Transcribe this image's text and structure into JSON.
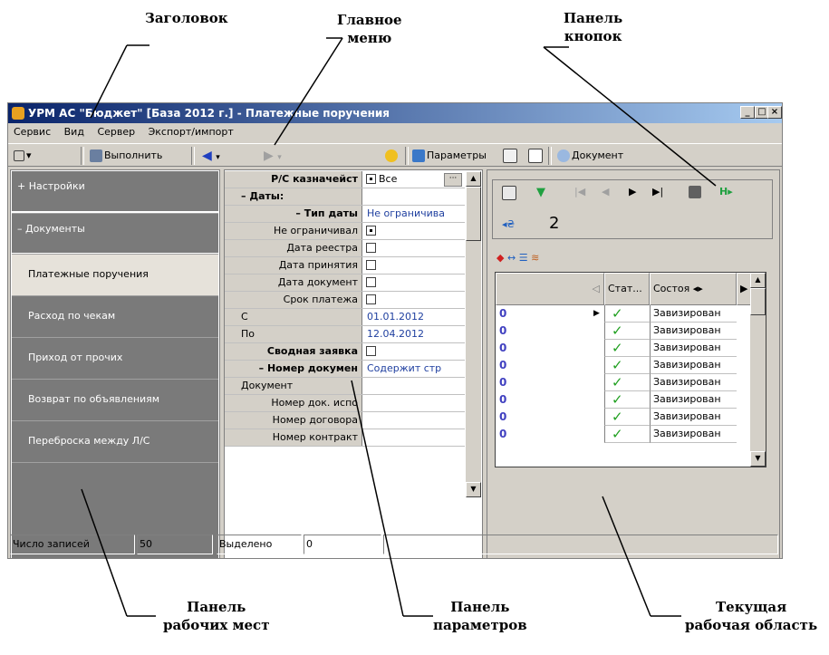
{
  "callouts": {
    "title": "Заголовок",
    "main_menu_1": "Главное",
    "main_menu_2": "меню",
    "button_panel_1": "Панель",
    "button_panel_2": "кнопок",
    "workplaces_1": "Панель",
    "workplaces_2": "рабочих мест",
    "params_1": "Панель",
    "params_2": "параметров",
    "workarea_1": "Текущая",
    "workarea_2": "рабочая область"
  },
  "window": {
    "title": "УРМ АС \"Бюджет\" [База 2012 г.] - Платежные поручения",
    "minimize": "_",
    "maximize": "□",
    "close": "×"
  },
  "menu": [
    "Сервис",
    "Вид",
    "Сервер",
    "Экспорт/импорт"
  ],
  "toolbar": {
    "execute": "Выполнить",
    "parameters": "Параметры",
    "document": "Документ"
  },
  "sidebar": {
    "settings": "+ Настройки",
    "documents": "– Документы",
    "items": [
      "Платежные поручения",
      "Расход по чекам",
      "Приход от прочих",
      "Возврат по объявлениям",
      "Переброска между Л/С"
    ],
    "scroll_down": "▼"
  },
  "params": {
    "rows": [
      {
        "name": "Р/С казначейст",
        "value": "Все",
        "bold": true,
        "radio": true
      },
      {
        "name": "– Даты:",
        "value": "",
        "bold": true,
        "left": true
      },
      {
        "name": "– Тип даты",
        "value": "Не ограничива",
        "bold": true
      },
      {
        "name": "Не ограничивал",
        "value": "",
        "check": "on"
      },
      {
        "name": "Дата реестра",
        "value": "",
        "check": "off"
      },
      {
        "name": "Дата принятия",
        "value": "",
        "check": "off"
      },
      {
        "name": "Дата документ",
        "value": "",
        "check": "off"
      },
      {
        "name": "Срок платежа",
        "value": "",
        "check": "off"
      },
      {
        "name": "С",
        "value": "01.01.2012",
        "left": true
      },
      {
        "name": "По",
        "value": "12.04.2012",
        "left": true
      },
      {
        "name": "Сводная заявка",
        "value": "",
        "bold": true,
        "check": "off"
      },
      {
        "name": "– Номер докумен",
        "value": "Содержит стр",
        "bold": true
      },
      {
        "name": "Документ",
        "value": "",
        "left": true
      },
      {
        "name": "Номер док. испо",
        "value": ""
      },
      {
        "name": "Номер договора",
        "value": ""
      },
      {
        "name": "Номер контракт",
        "value": ""
      }
    ]
  },
  "workarea": {
    "page_number": "2",
    "columns": [
      "Стат...",
      "Состоя"
    ],
    "rows": [
      {
        "id": "0",
        "status": "✓",
        "state": "Завизирован"
      },
      {
        "id": "0",
        "status": "✓",
        "state": "Завизирован"
      },
      {
        "id": "0",
        "status": "✓",
        "state": "Завизирован"
      },
      {
        "id": "0",
        "status": "✓",
        "state": "Завизирован"
      },
      {
        "id": "0",
        "status": "✓",
        "state": "Завизирован"
      },
      {
        "id": "0",
        "status": "✓",
        "state": "Завизирован"
      },
      {
        "id": "0",
        "status": "✓",
        "state": "Завизирован"
      },
      {
        "id": "0",
        "status": "✓",
        "state": "Завизирован"
      }
    ]
  },
  "status": {
    "records_label": "Число записей",
    "records_value": "50",
    "selected_label": "Выделено",
    "selected_value": "0"
  }
}
